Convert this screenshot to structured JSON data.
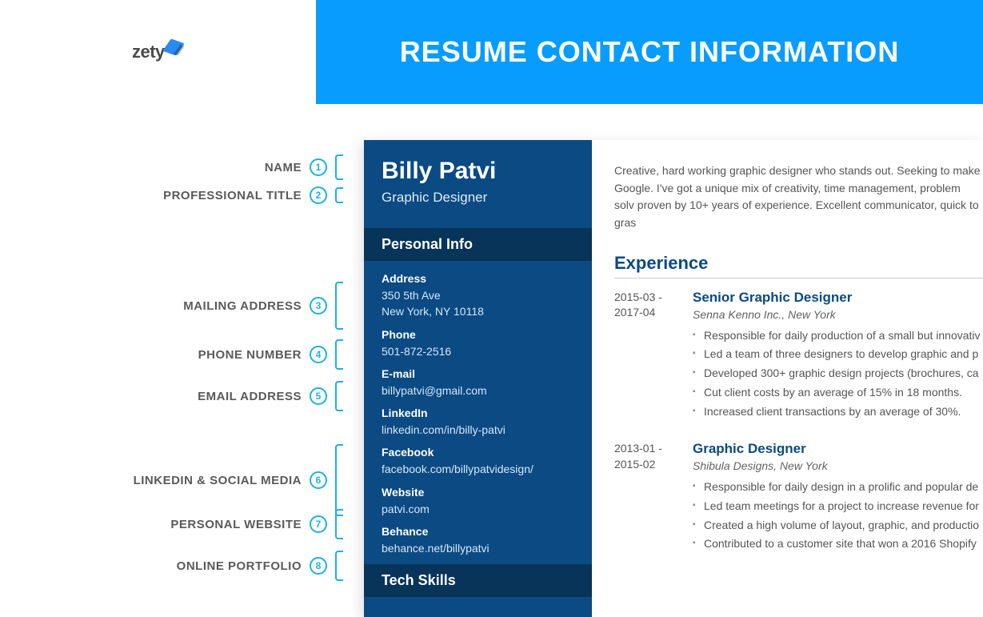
{
  "logo": "zety",
  "banner": "RESUME CONTACT INFORMATION",
  "annotations": [
    {
      "label": "NAME",
      "num": "1"
    },
    {
      "label": "PROFESSIONAL TITLE",
      "num": "2"
    },
    {
      "label": "MAILING ADDRESS",
      "num": "3"
    },
    {
      "label": "PHONE NUMBER",
      "num": "4"
    },
    {
      "label": "EMAIL ADDRESS",
      "num": "5"
    },
    {
      "label": "LINKEDIN & SOCIAL MEDIA",
      "num": "6"
    },
    {
      "label": "PERSONAL WEBSITE",
      "num": "7"
    },
    {
      "label": "ONLINE PORTFOLIO",
      "num": "8"
    }
  ],
  "resume": {
    "name": "Billy Patvi",
    "title": "Graphic Designer",
    "personal_info_heading": "Personal Info",
    "tech_skills_heading": "Tech Skills",
    "contact": {
      "address_label": "Address",
      "address_line1": "350 5th Ave",
      "address_line2": "New York, NY 10118",
      "phone_label": "Phone",
      "phone": "501-872-2516",
      "email_label": "E-mail",
      "email": "billypatvi@gmail.com",
      "linkedin_label": "LinkedIn",
      "linkedin": "linkedin.com/in/billy-patvi",
      "facebook_label": "Facebook",
      "facebook": "facebook.com/billypatvidesign/",
      "website_label": "Website",
      "website": "patvi.com",
      "behance_label": "Behance",
      "behance": "behance.net/billypatvi"
    },
    "summary": "Creative, hard working graphic designer who stands out. Seeking to make Google. I've got a unique mix of creativity, time management, problem solv proven by 10+ years of experience. Excellent communicator, quick to gras",
    "experience_heading": "Experience",
    "jobs": [
      {
        "date_from": "2015-03 -",
        "date_to": "2017-04",
        "title": "Senior Graphic Designer",
        "company": "Senna Kenno Inc., New York",
        "bullets": [
          "Responsible for daily production of a small but innovativ",
          "Led a team of three designers to develop graphic and p",
          "Developed 300+ graphic design projects (brochures, ca",
          "Cut client costs by an average of 15% in 18 months.",
          "Increased client transactions by an average of 30%."
        ]
      },
      {
        "date_from": "2013-01 -",
        "date_to": "2015-02",
        "title": "Graphic Designer",
        "company": "Shibula Designs, New York",
        "bullets": [
          "Responsible for daily design in a prolific and popular de",
          "Led team meetings for a project to increase revenue for",
          "Created a high volume of layout, graphic, and productio",
          "Contributed to a customer site that won a 2016 Shopify"
        ]
      }
    ]
  }
}
